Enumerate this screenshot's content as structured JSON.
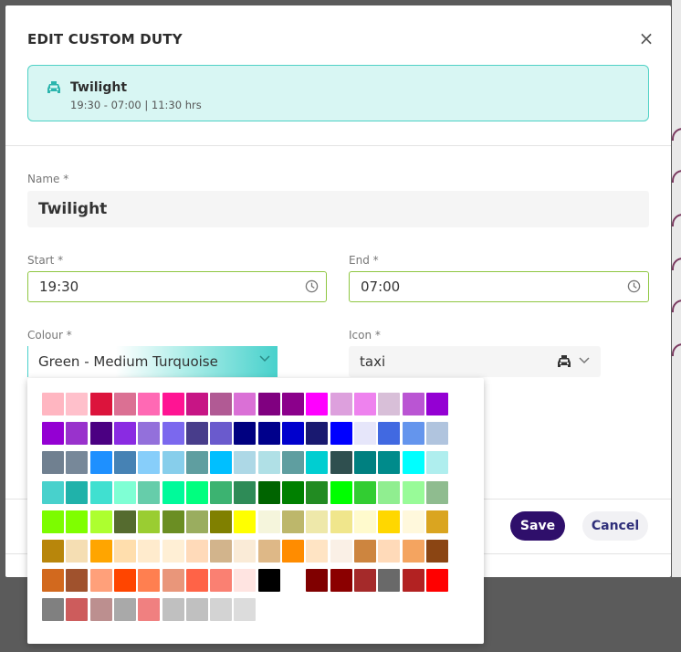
{
  "dialog": {
    "title": "EDIT CUSTOM DUTY",
    "close_label": "×"
  },
  "preview": {
    "icon": "taxi-icon",
    "name": "Twilight",
    "details": "19:30 - 07:00 | 11:30 hrs"
  },
  "form": {
    "name_label": "Name *",
    "name_value": "Twilight",
    "start_label": "Start *",
    "start_value": "19:30",
    "end_label": "End *",
    "end_value": "07:00",
    "colour_label": "Colour *",
    "colour_value": "Green - Medium Turquoise",
    "icon_label": "Icon *",
    "icon_value": "taxi"
  },
  "actions": {
    "save_label": "Save",
    "cancel_label": "Cancel"
  },
  "colors": {
    "accent": "#48d1cc",
    "valid_border": "#8fc742",
    "primary_button": "#2f0f6b"
  },
  "palette": {
    "rows": [
      [
        "#ffb6c1",
        "#ffc0cb",
        "#dc143c",
        "#db7093",
        "#ff69b4",
        "#ff1493",
        "#c71585",
        "#b15a94",
        "#da70d6",
        "#800080",
        "#8b008b",
        "#ff00ff",
        "#dda0dd",
        "#ee82ee",
        "#d8bfd8",
        "#ba55d3",
        "#9400d3"
      ],
      [
        "#9400d3",
        "#9932cc",
        "#4b0082",
        "#8a2be2",
        "#9370db",
        "#7b68ee",
        "#483d8b",
        "#6a5acd",
        "#000080",
        "#00008b",
        "#0000cd",
        "#191970",
        "#0000ff",
        "#e6e6fa",
        "#4169e1",
        "#6495ed",
        "#b0c4de"
      ],
      [
        "#708090",
        "#778899",
        "#1e90ff",
        "#4682b4",
        "#87cefa",
        "#87ceeb",
        "#5f9ea0",
        "#00bfff",
        "#add8e6",
        "#b0e0e6",
        "#5f9ea0",
        "#00ced1",
        "#2f4f4f",
        "#008080",
        "#008b8b",
        "#00ffff",
        "#afeeee"
      ],
      [
        "#48d1cc",
        "#20b2aa",
        "#40e0d0",
        "#7fffd4",
        "#66cdaa",
        "#00fa9a",
        "#00ff7f",
        "#3cb371",
        "#2e8b57",
        "#006400",
        "#008000",
        "#228b22",
        "#00ff00",
        "#32cd32",
        "#90ee90",
        "#98fb98",
        "#8fbc8f"
      ],
      [
        "#7cfc00",
        "#7fff00",
        "#adff2f",
        "#556b2f",
        "#9acd32",
        "#6b8e23",
        "#9aad5f",
        "#808000",
        "#ffff00",
        "#f5f5dc",
        "#bdb76b",
        "#eee8aa",
        "#f0e68c",
        "#fffacd",
        "#ffd700",
        "#fff8dc",
        "#daa520"
      ],
      [
        "#b8860b",
        "#f5deb3",
        "#ffa500",
        "#ffdead",
        "#ffebcd",
        "#ffefd5",
        "#ffdab9",
        "#d2b48c",
        "#faebd7",
        "#deb887",
        "#ff8c00",
        "#ffe4c4",
        "#faf0e6",
        "#cd853f",
        "#ffdab9",
        "#f4a460",
        "#8b4513"
      ],
      [
        "#d2691e",
        "#a0522d",
        "#ffa07a",
        "#ff4500",
        "#ff7f50",
        "#e9967a",
        "#ff6347",
        "#fa8072",
        "#ffe4e1",
        "#000000",
        "#ffffff",
        "#800000",
        "#8b0000",
        "#a52a2a",
        "#696969",
        "#b22222",
        "#ff0000"
      ],
      [
        "#808080",
        "#cd5c5c",
        "#bc8f8f",
        "#a9a9a9",
        "#f08080",
        "#c0c0c0",
        "#c0c0c0",
        "#d3d3d3",
        "#dcdcdc"
      ]
    ]
  }
}
